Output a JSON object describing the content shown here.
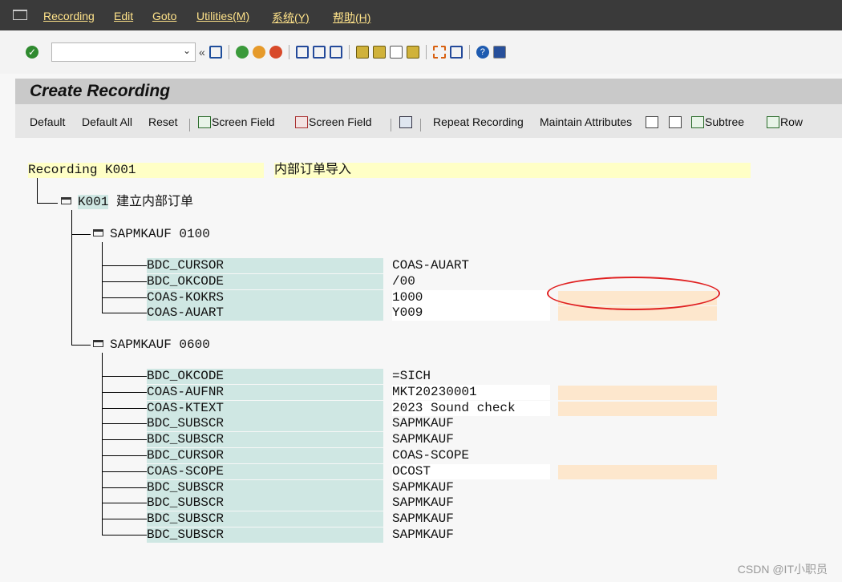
{
  "menubar": {
    "items": [
      "Recording",
      "Edit",
      "Goto",
      "Utilities(M)",
      "系统(Y)",
      "帮助(H)"
    ]
  },
  "toolbar": {
    "command_value": "",
    "icons": [
      "enter-icon",
      "save-icon",
      "back-icon",
      "exit-icon",
      "cancel-icon",
      "print-icon",
      "find-icon",
      "find-next-icon",
      "first-page-icon",
      "prev-page-icon",
      "next-page-icon",
      "last-page-icon",
      "new-session-icon",
      "shortcut-icon",
      "help-icon",
      "layout-icon"
    ]
  },
  "page": {
    "title": "Create Recording"
  },
  "app_toolbar": {
    "default": "Default",
    "default_all": "Default All",
    "reset": "Reset",
    "screen_field_insert": "Screen Field",
    "screen_field_delete": "Screen Field",
    "repeat_recording": "Repeat Recording",
    "maintain_attributes": "Maintain Attributes",
    "subtree": "Subtree",
    "row": "Row"
  },
  "recording": {
    "label": "Recording K001",
    "description": "内部订单导入",
    "transaction_code": "K001",
    "transaction_text": "建立内部订单",
    "screens": [
      {
        "program": "SAPMKAUF",
        "dynpro": "0100",
        "fields": [
          {
            "name": "BDC_CURSOR",
            "value": "COAS-AUART",
            "input": false
          },
          {
            "name": "BDC_OKCODE",
            "value": "/00",
            "input": false
          },
          {
            "name": "COAS-KOKRS",
            "value": "1000",
            "input": true
          },
          {
            "name": "COAS-AUART",
            "value": "Y009",
            "input": true
          }
        ]
      },
      {
        "program": "SAPMKAUF",
        "dynpro": "0600",
        "fields": [
          {
            "name": "BDC_OKCODE",
            "value": "=SICH",
            "input": false
          },
          {
            "name": "COAS-AUFNR",
            "value": "MKT20230001",
            "input": true
          },
          {
            "name": "COAS-KTEXT",
            "value": "2023 Sound check",
            "input": true
          },
          {
            "name": "BDC_SUBSCR",
            "value": "SAPMKAUF",
            "input": false
          },
          {
            "name": "BDC_SUBSCR",
            "value": "SAPMKAUF",
            "input": false
          },
          {
            "name": "BDC_CURSOR",
            "value": "COAS-SCOPE",
            "input": false
          },
          {
            "name": "COAS-SCOPE",
            "value": "OCOST",
            "input": true
          },
          {
            "name": "BDC_SUBSCR",
            "value": "SAPMKAUF",
            "input": false
          },
          {
            "name": "BDC_SUBSCR",
            "value": "SAPMKAUF",
            "input": false
          },
          {
            "name": "BDC_SUBSCR",
            "value": "SAPMKAUF",
            "input": false
          },
          {
            "name": "BDC_SUBSCR",
            "value": "SAPMKAUF",
            "input": false
          }
        ]
      }
    ]
  },
  "watermark": "CSDN @IT小职员",
  "colors": {
    "menubar": "#3a3a3a",
    "title_bar": "#c9c9c9",
    "field_name_bg": "#cfe7e3",
    "description_bg": "#ffffc6",
    "empty_field_bg": "#fde7cd",
    "annotation": "#e02020"
  }
}
